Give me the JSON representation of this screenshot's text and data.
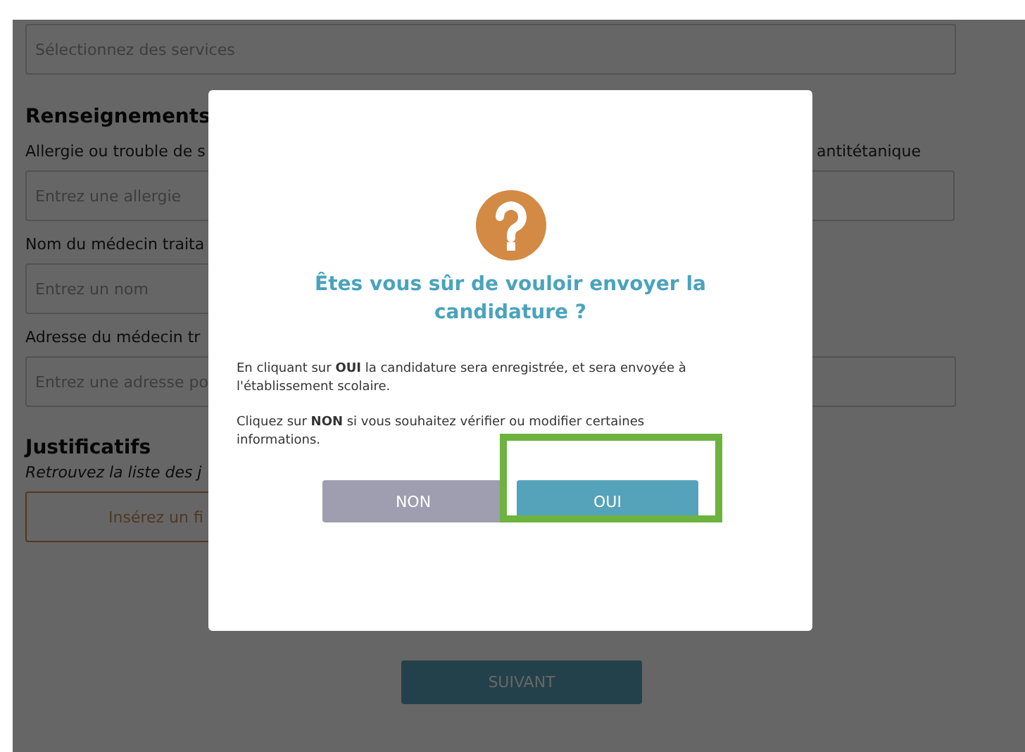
{
  "form": {
    "services_field": {
      "placeholder": "Sélectionnez des services"
    },
    "medical_section": {
      "title": "Renseignements",
      "allergy": {
        "label": "Allergie ou trouble de s",
        "placeholder": "Entrez une allergie"
      },
      "vaccine": {
        "label": "antitétanique"
      },
      "doctor_name": {
        "label": "Nom du médecin traita",
        "placeholder": "Entrez un nom"
      },
      "doctor_address": {
        "label": "Adresse du médecin tr",
        "placeholder": "Entrez une adresse po"
      }
    },
    "documents_section": {
      "title": "Justificatifs",
      "subtitle": "Retrouvez la liste des j",
      "file_button": "Insérez un fi"
    },
    "next_button": "SUIVANT"
  },
  "dialog": {
    "title": "Êtes vous sûr de vouloir envoyer la candidature ?",
    "paragraphs": [
      "En cliquant sur **OUI** la candidature sera enregistrée, et sera envoyée à l'établissement scolaire.",
      "Cliquez sur **NON** si vous souhaitez vérifier ou modifier certaines informations."
    ],
    "buttons": [
      {
        "label": "NON",
        "kind": "cancel",
        "highlighted": false
      },
      {
        "label": "OUI",
        "kind": "confirm",
        "highlighted": true
      }
    ]
  }
}
